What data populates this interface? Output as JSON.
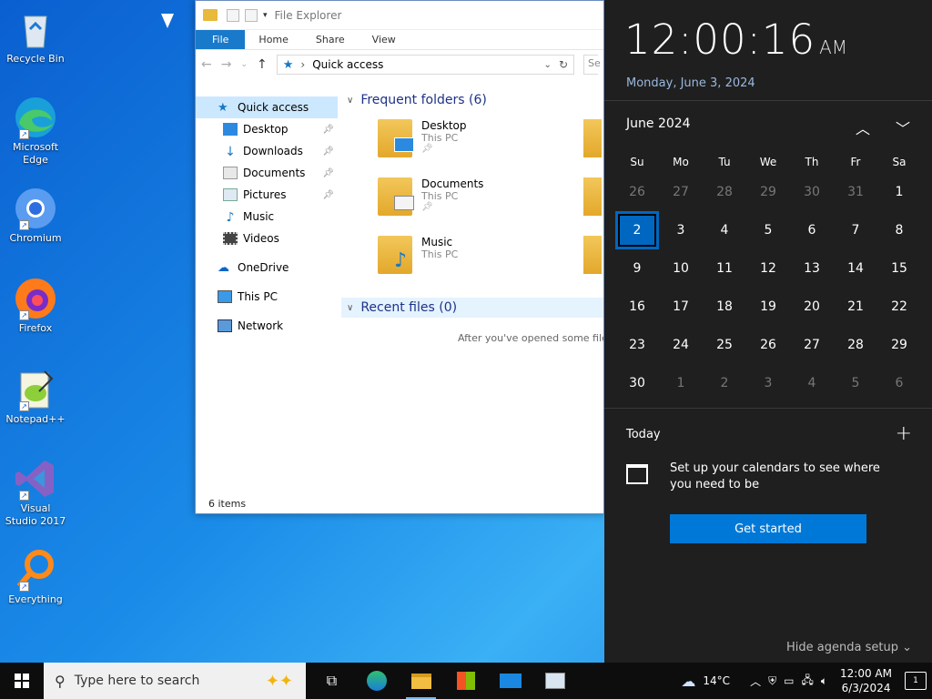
{
  "desktop": {
    "icons": [
      {
        "label": "Recycle Bin"
      },
      {
        "label": "Microsoft Edge"
      },
      {
        "label": "Chromium"
      },
      {
        "label": "Firefox"
      },
      {
        "label": "Notepad++"
      },
      {
        "label": "Visual Studio 2017"
      },
      {
        "label": "Everything"
      }
    ]
  },
  "explorer": {
    "title": "File Explorer",
    "tabs": [
      "File",
      "Home",
      "Share",
      "View"
    ],
    "address": "Quick access",
    "search_placeholder": "Se",
    "nav": {
      "quick_access": "Quick access",
      "items": [
        "Desktop",
        "Downloads",
        "Documents",
        "Pictures",
        "Music",
        "Videos"
      ],
      "onedrive": "OneDrive",
      "this_pc": "This PC",
      "network": "Network"
    },
    "frequent_header": "Frequent folders (6)",
    "folders": [
      {
        "name": "Desktop",
        "location": "This PC"
      },
      {
        "name": "Documents",
        "location": "This PC"
      },
      {
        "name": "Music",
        "location": "This PC"
      }
    ],
    "recent_header": "Recent files (0)",
    "recent_message": "After you've opened some files",
    "status": "6 items"
  },
  "flyout": {
    "time": "12:00:16",
    "ampm": "AM",
    "long_date": "Monday, June 3, 2024",
    "month_label": "June 2024",
    "weekdays": [
      "Su",
      "Mo",
      "Tu",
      "We",
      "Th",
      "Fr",
      "Sa"
    ],
    "weeks": [
      [
        "26",
        "27",
        "28",
        "29",
        "30",
        "31",
        "1"
      ],
      [
        "2",
        "3",
        "4",
        "5",
        "6",
        "7",
        "8"
      ],
      [
        "9",
        "10",
        "11",
        "12",
        "13",
        "14",
        "15"
      ],
      [
        "16",
        "17",
        "18",
        "19",
        "20",
        "21",
        "22"
      ],
      [
        "23",
        "24",
        "25",
        "26",
        "27",
        "28",
        "29"
      ],
      [
        "30",
        "1",
        "2",
        "3",
        "4",
        "5",
        "6"
      ]
    ],
    "agenda_title": "Today",
    "agenda_message": "Set up your calendars to see where you need to be",
    "get_started": "Get started",
    "hide_agenda": "Hide agenda setup"
  },
  "taskbar": {
    "search_placeholder": "Type here to search",
    "weather": "14°C",
    "time": "12:00 AM",
    "date": "6/3/2024",
    "notification_count": "1"
  }
}
